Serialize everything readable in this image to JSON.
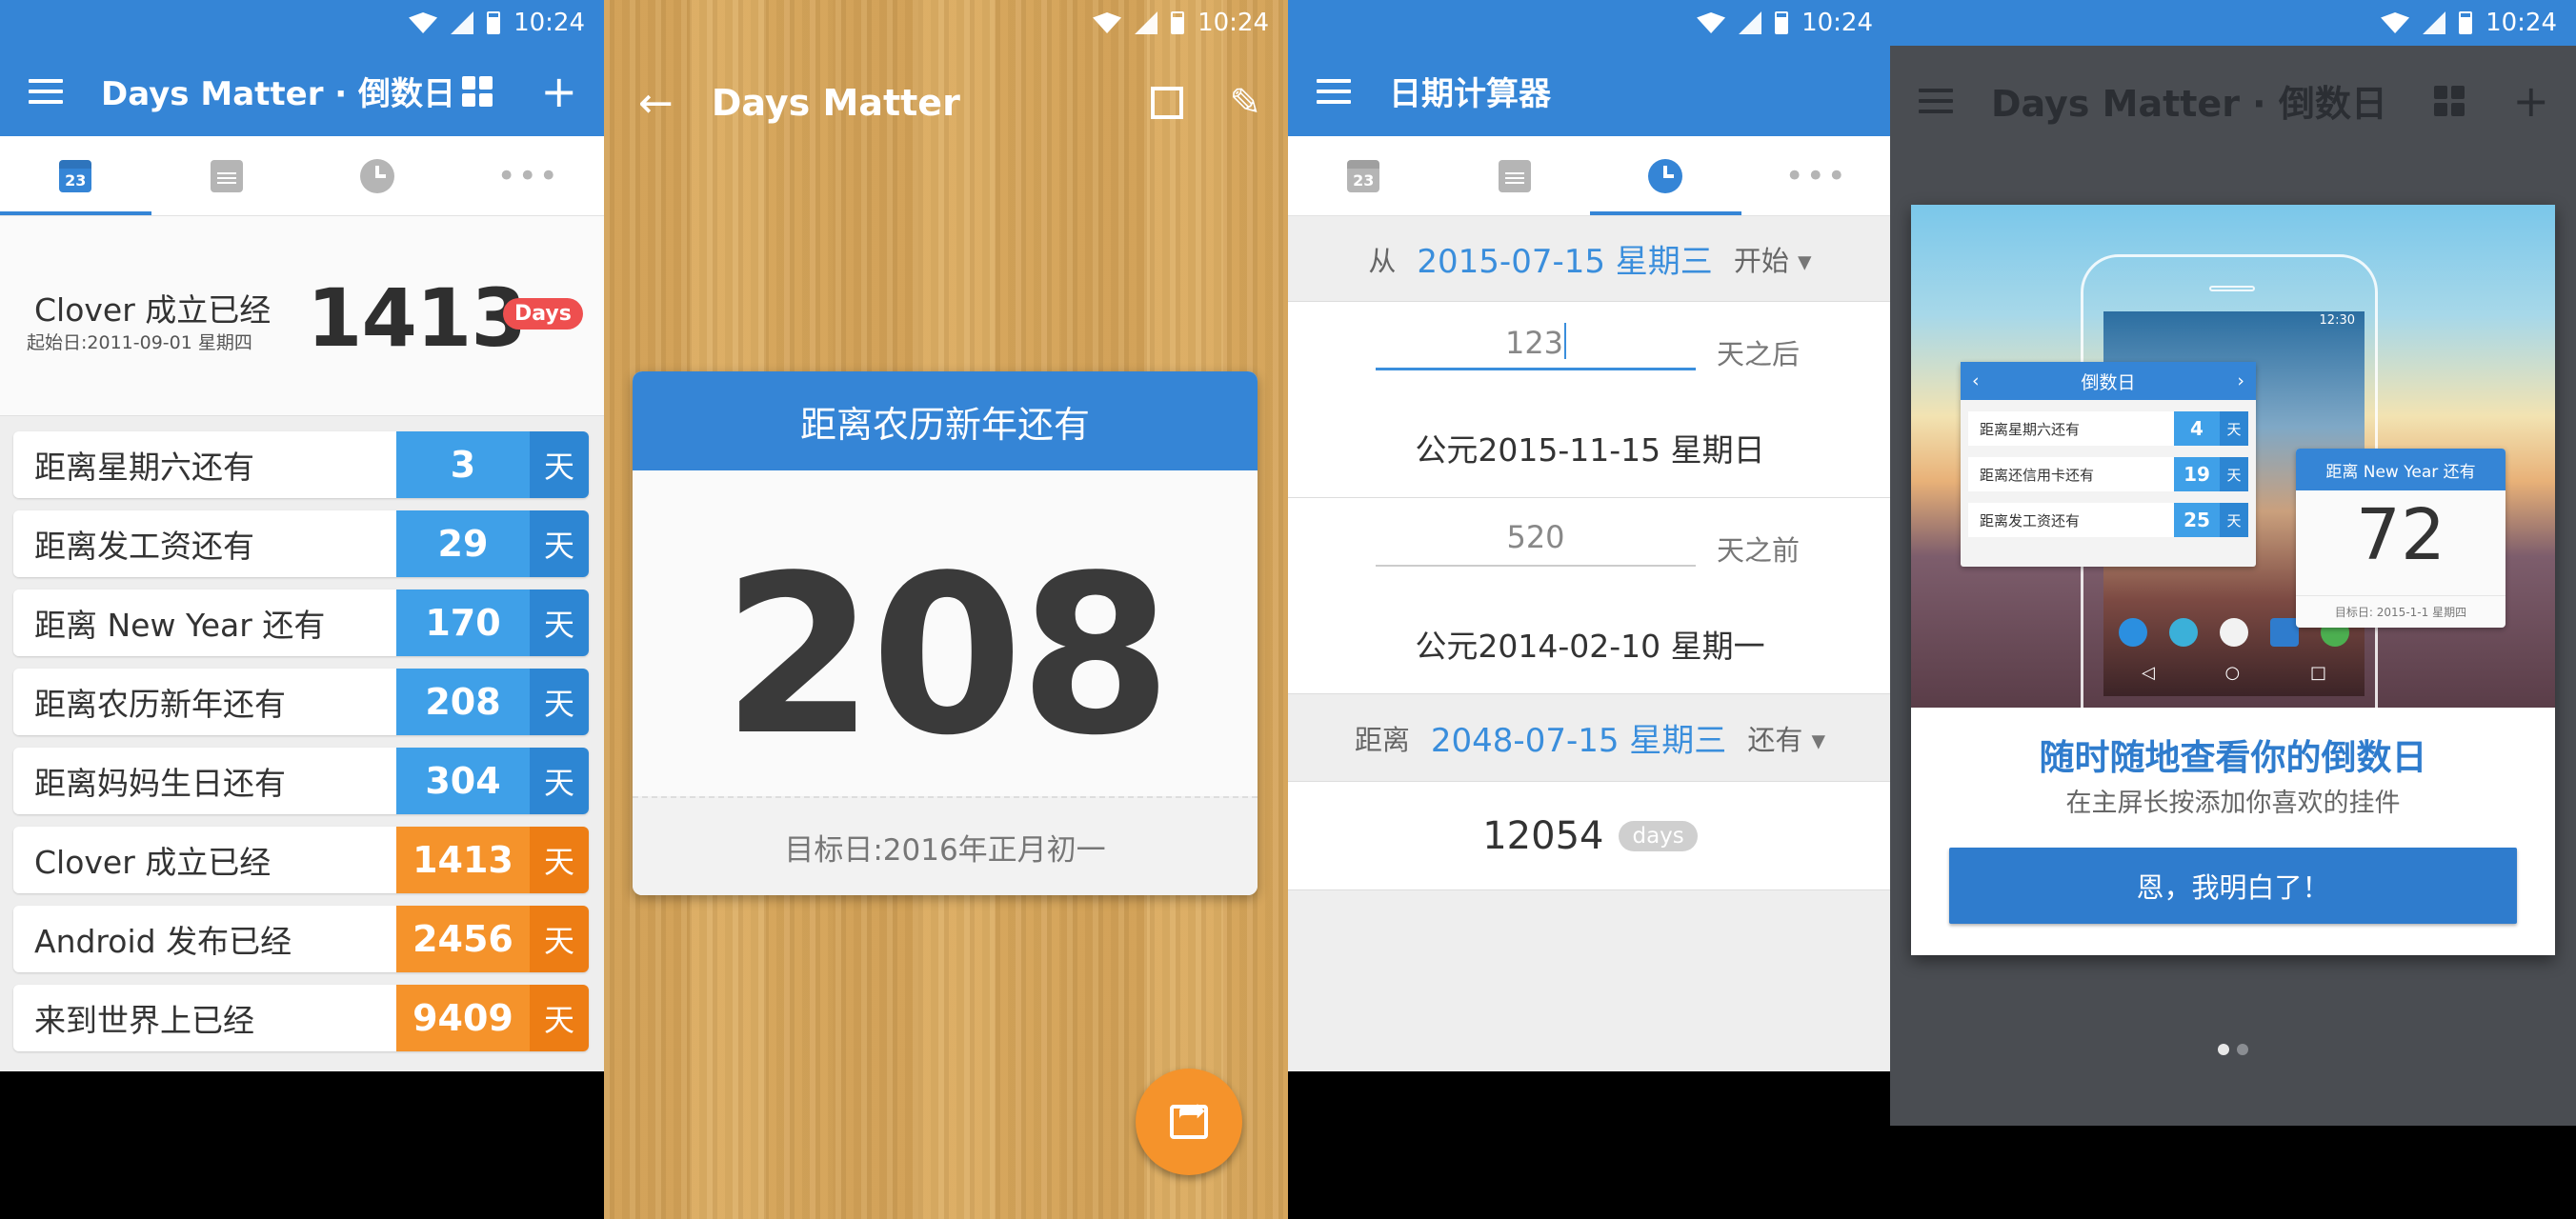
{
  "status_bar": {
    "time": "10:24"
  },
  "icons": {
    "menu": "menu-icon",
    "widgets": "grid-icon",
    "add": "plus-icon",
    "back": "arrow-back-icon",
    "crop": "crop-icon",
    "edit": "pencil-icon",
    "share": "share-icon"
  },
  "colors": {
    "primary": "#3585d6",
    "future": "#3fa0e8",
    "past": "#f5932b",
    "badge": "#ee4f4f"
  },
  "tabs": {
    "date_number": "23"
  },
  "list_screen": {
    "app_title": "Days Matter · 倒数日",
    "hero": {
      "title": "Clover 成立已经",
      "start_date": "起始日:2011-09-01 星期四",
      "days": "1413",
      "badge": "Days"
    },
    "rows": [
      {
        "label": "距离星期六还有",
        "days": "3",
        "unit": "天",
        "kind": "future"
      },
      {
        "label": "距离发工资还有",
        "days": "29",
        "unit": "天",
        "kind": "future"
      },
      {
        "label": "距离 New Year 还有",
        "days": "170",
        "unit": "天",
        "kind": "future"
      },
      {
        "label": "距离农历新年还有",
        "days": "208",
        "unit": "天",
        "kind": "future"
      },
      {
        "label": "距离妈妈生日还有",
        "days": "304",
        "unit": "天",
        "kind": "future"
      },
      {
        "label": "Clover 成立已经",
        "days": "1413",
        "unit": "天",
        "kind": "past"
      },
      {
        "label": "Android 发布已经",
        "days": "2456",
        "unit": "天",
        "kind": "past"
      },
      {
        "label": "来到世界上已经",
        "days": "9409",
        "unit": "天",
        "kind": "past"
      }
    ]
  },
  "detail_screen": {
    "title": "Days Matter",
    "card_title": "距离农历新年还有",
    "days": "208",
    "target": "目标日:2016年正月初一"
  },
  "calc_screen": {
    "title": "日期计算器",
    "from_label": "从",
    "from_date": "2015-07-15 星期三",
    "from_mode": "开始",
    "add_value": "123",
    "add_suffix": "天之后",
    "add_result": "公元2015-11-15 星期日",
    "sub_value": "520",
    "sub_suffix": "天之前",
    "sub_result": "公元2014-02-10 星期一",
    "to_label": "距离",
    "to_date": "2048-07-15 星期三",
    "to_mode": "还有",
    "diff_days": "12054",
    "diff_unit": "days"
  },
  "widget_screen": {
    "bg_title": "Days Matter · 倒数日",
    "mini_list": {
      "header": "倒数日",
      "prev": "‹",
      "next": "›",
      "rows": [
        {
          "label": "距离星期六还有",
          "days": "4",
          "unit": "天"
        },
        {
          "label": "距离还信用卡还有",
          "days": "19",
          "unit": "天"
        },
        {
          "label": "距离发工资还有",
          "days": "25",
          "unit": "天"
        }
      ]
    },
    "mini_card": {
      "header": "距离 New Year 还有",
      "days": "72",
      "footer": "目标日:  2015-1-1 星期四"
    },
    "phone_time": "12:30",
    "dialog_title": "随时随地查看你的倒数日",
    "dialog_subtitle": "在主屏长按添加你喜欢的挂件",
    "dialog_button": "恩，我明白了！",
    "pager": {
      "count": 2,
      "active": 0
    }
  }
}
